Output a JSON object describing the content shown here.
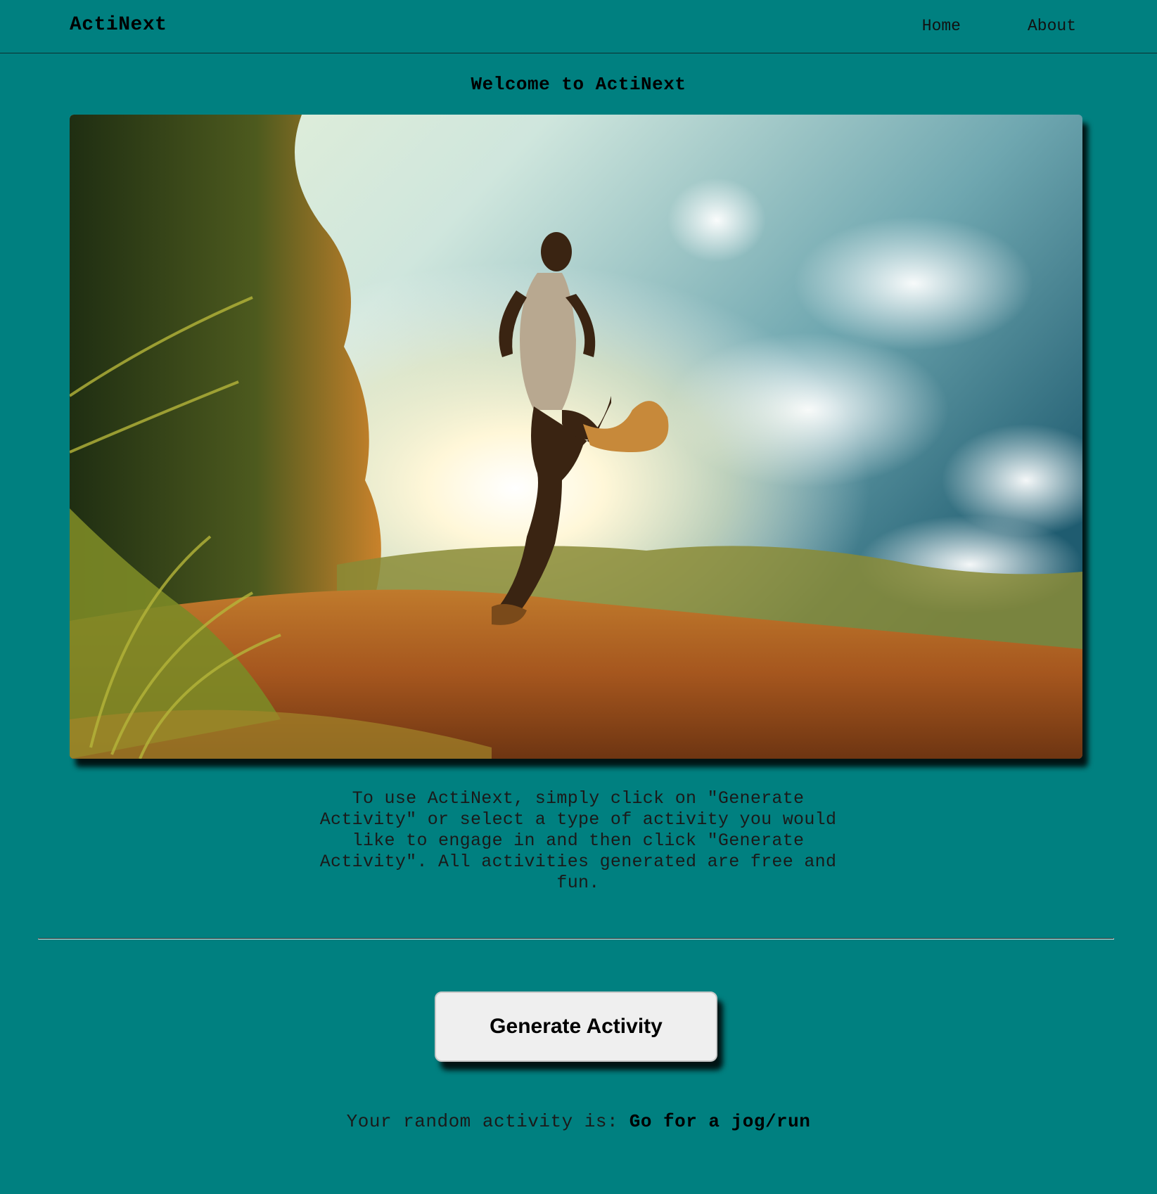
{
  "app": {
    "brand": "ActiNext"
  },
  "nav": {
    "links": [
      {
        "label": "Home"
      },
      {
        "label": "About"
      }
    ]
  },
  "hero": {
    "heading": "Welcome to ActiNext"
  },
  "instructions": {
    "text": "To use ActiNext, simply click on \"Generate Activity\" or select a type of activity you would like to engage in and then click \"Generate Activity\". All activities generated are free and fun."
  },
  "actions": {
    "generate_label": "Generate Activity"
  },
  "result": {
    "label": "Your random activity is:",
    "value": "Go for a jog/run"
  },
  "colors": {
    "background": "#008080",
    "button_bg": "#efefef"
  }
}
